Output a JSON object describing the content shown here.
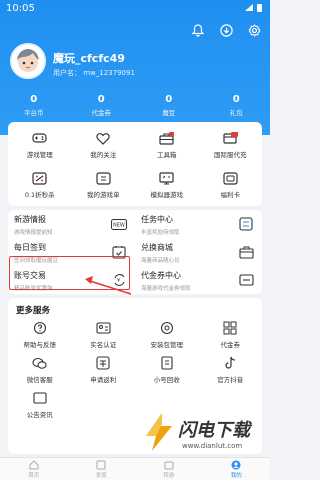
{
  "status": {
    "time": "10:05"
  },
  "user": {
    "name": "魔玩_cfcfc49",
    "id": "用户名： mw_12379091"
  },
  "stats": [
    {
      "value": "0",
      "label": "平台币"
    },
    {
      "value": "0",
      "label": "代金券"
    },
    {
      "value": "0",
      "label": "魔豆"
    },
    {
      "value": "0",
      "label": "礼包"
    }
  ],
  "tools": [
    {
      "label": "游戏管理"
    },
    {
      "label": "我的关注"
    },
    {
      "label": "工具箱"
    },
    {
      "label": "国际服代充"
    },
    {
      "label": "0.1折秒杀"
    },
    {
      "label": "我的游戏单"
    },
    {
      "label": "模拟器游戏"
    },
    {
      "label": "福利卡"
    }
  ],
  "services": [
    {
      "title": "新游情报",
      "sub": "游戏情报提前知"
    },
    {
      "title": "任务中心",
      "sub": "丰富奖励待领取"
    },
    {
      "title": "每日签到",
      "sub": "签到领取魔玩魔豆"
    },
    {
      "title": "兑换商城",
      "sub": "海量商品随心兑"
    },
    {
      "title": "账号交易",
      "sub": "精品账号优惠淘"
    },
    {
      "title": "代金券中心",
      "sub": "海量游戏代金券领取"
    }
  ],
  "more": {
    "title": "更多服务",
    "items": [
      {
        "label": "帮助与反馈"
      },
      {
        "label": "实名认证"
      },
      {
        "label": "安装包管理"
      },
      {
        "label": "代金券"
      },
      {
        "label": "微信客服"
      },
      {
        "label": "申请返利"
      },
      {
        "label": "小号回收"
      },
      {
        "label": "官方抖音"
      },
      {
        "label": "公告资讯"
      }
    ]
  },
  "nav": [
    {
      "label": "首页"
    },
    {
      "label": "发现"
    },
    {
      "label": "转游"
    },
    {
      "label": "我的"
    }
  ],
  "watermark": {
    "text": "闪电下载",
    "url": "www.dianlut.com"
  },
  "colors": {
    "primary": "#2b8ef1",
    "highlight": "#e53935"
  }
}
